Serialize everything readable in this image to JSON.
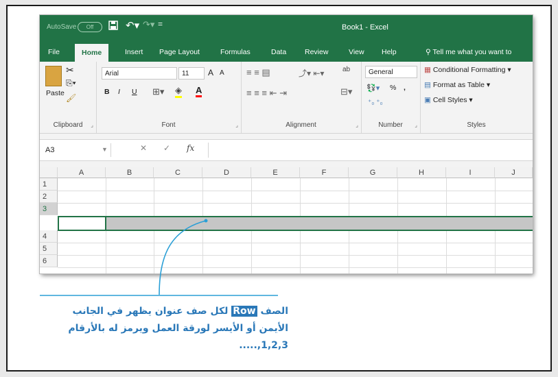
{
  "titlebar": {
    "autosave_label": "AutoSave",
    "autosave_state": "Off",
    "quick_access": "=",
    "title": "Book1  -  Excel"
  },
  "tabs": [
    "File",
    "Home",
    "Insert",
    "Page Layout",
    "Formulas",
    "Data",
    "Review",
    "View",
    "Help"
  ],
  "active_tab": "Home",
  "search_placeholder": "Tell me what you want to",
  "ribbon": {
    "clipboard": {
      "paste": "Paste",
      "label": "Clipboard"
    },
    "font": {
      "name": "Arial",
      "size": "11",
      "grow": "A",
      "shrink": "A",
      "bold": "B",
      "italic": "I",
      "underline": "U",
      "fill_color": "#ffff00",
      "font_color": "#ff0000",
      "label": "Font"
    },
    "alignment": {
      "wrap": "ab",
      "label": "Alignment"
    },
    "number": {
      "format": "General",
      "percent": "%",
      "comma": ",",
      "label": "Number"
    },
    "styles": {
      "conditional": "Conditional Formatting",
      "table": "Format as Table",
      "cell_styles": "Cell Styles",
      "label": "Styles"
    }
  },
  "formula_bar": {
    "name_box": "A3",
    "cancel": "✕",
    "enter": "✓",
    "fx": "fx",
    "value": ""
  },
  "columns": [
    "A",
    "B",
    "C",
    "D",
    "E",
    "F",
    "G",
    "H",
    "I",
    "J"
  ],
  "rows": [
    "1",
    "2",
    "3",
    "4",
    "5",
    "6"
  ],
  "selected_row": "3",
  "accent_color": "#217346",
  "annotation": {
    "line1_before": "الصف",
    "line1_highlight": "Row",
    "line1_after": "لكل صف عنوان يظهر في الجانب",
    "line2": "الأيمن أو الأيسر لورقة العمل ويرمز له بالأرقام",
    "line3": "1,2,3,.....",
    "color": "#2a78b8"
  }
}
